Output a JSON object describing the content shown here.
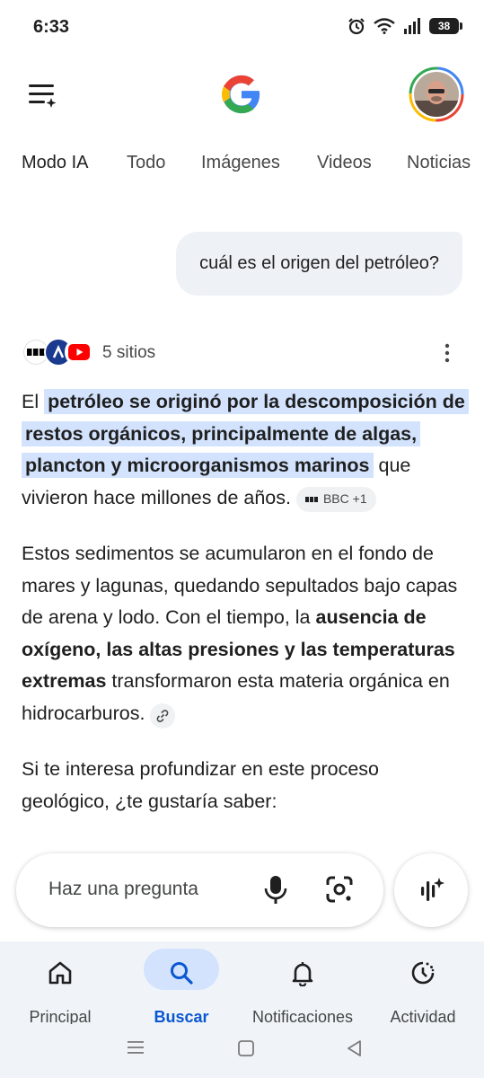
{
  "status_bar": {
    "time": "6:33",
    "battery": "38"
  },
  "header": {
    "menu_icon": "menu-sparkle-icon",
    "logo": "google-g-logo",
    "avatar": "profile-avatar"
  },
  "tabs": [
    {
      "label": "Modo IA",
      "active": true
    },
    {
      "label": "Todo"
    },
    {
      "label": "Imágenes"
    },
    {
      "label": "Videos"
    },
    {
      "label": "Noticias"
    }
  ],
  "query": "cuál es el origen del petróleo?",
  "sources": {
    "count_label": "5 sitios"
  },
  "answer": {
    "p1": {
      "lead": "El ",
      "highlight": "petróleo se originó por la descomposición de restos orgánicos, principalmente de algas, plancton y microorganismos marinos",
      "tail": " que vivieron hace millones de años.",
      "chip": "BBC +1"
    },
    "p2": {
      "text1": "Estos sedimentos se acumularon en el fondo de mares y lagunas, quedando sepultados bajo capas de arena y lodo. Con el tiempo, la ",
      "bold": "ausencia de oxígeno, las altas presiones y las temperaturas extremas",
      "text2": " transformaron esta materia orgánica en hidrocarburos."
    },
    "p3": {
      "text": "Si te interesa profundizar en este proceso geológico, ¿te gustaría saber:"
    }
  },
  "ask_bar": {
    "placeholder": "Haz una pregunta"
  },
  "bottom_nav": [
    {
      "label": "Principal",
      "icon": "home-icon"
    },
    {
      "label": "Buscar",
      "icon": "search-icon",
      "active": true
    },
    {
      "label": "Notificaciones",
      "icon": "bell-icon"
    },
    {
      "label": "Actividad",
      "icon": "activity-icon"
    }
  ],
  "colors": {
    "accent": "#0b57d0",
    "highlight": "#d3e3fd",
    "nav_bg": "#f0f4f9"
  }
}
